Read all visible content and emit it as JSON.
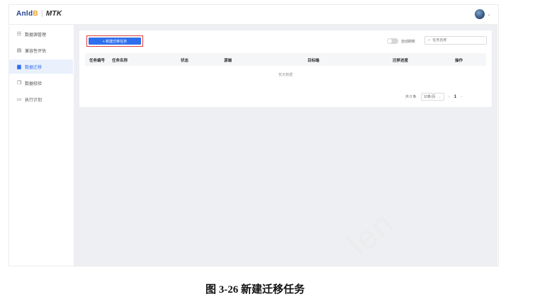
{
  "header": {
    "brand_a": "Anld",
    "brand_b": "B",
    "product": "MTK"
  },
  "sidebar": {
    "items": [
      {
        "label": "数据源管理",
        "icon": "database-icon",
        "glyph": "☷",
        "active": false
      },
      {
        "label": "兼容性评估",
        "icon": "document-icon",
        "glyph": "▤",
        "active": false
      },
      {
        "label": "数据迁移",
        "icon": "folder-icon",
        "glyph": "▆",
        "active": true
      },
      {
        "label": "数据校验",
        "icon": "copy-icon",
        "glyph": "❐",
        "active": false
      },
      {
        "label": "执行计划",
        "icon": "calendar-icon",
        "glyph": "▭",
        "active": false
      }
    ]
  },
  "toolbar": {
    "new_task_label": "+ 新建迁移任务",
    "auto_refresh_label": "自动刷新",
    "search_placeholder": "任务名称"
  },
  "table": {
    "columns": [
      "任务编号",
      "任务名称",
      "状态",
      "源端",
      "目标端",
      "迁移进度",
      "操作"
    ],
    "empty_text": "暂无数据"
  },
  "pagination": {
    "total_label": "共 0 条",
    "page_size": "10条/页",
    "current_page": "1",
    "prev": "‹",
    "next": "›"
  },
  "caption": "图 3-26  新建迁移任务",
  "watermark": "len"
}
